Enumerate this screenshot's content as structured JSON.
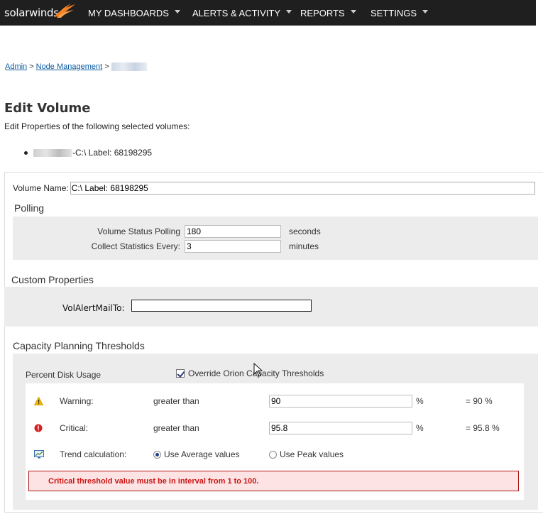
{
  "header": {
    "logo_text": "solarwinds",
    "nav": [
      "MY DASHBOARDS",
      "ALERTS & ACTIVITY",
      "REPORTS",
      "SETTINGS"
    ],
    "bg_color": "#1f1f1f",
    "accent_color": "#f47c20"
  },
  "breadcrumb": {
    "items": [
      "Admin",
      "Node Management"
    ],
    "separator": ">"
  },
  "page": {
    "title": "Edit Volume",
    "subtitle": "Edit Properties of the following selected volumes:",
    "selected_volume_suffix": "-C:\\ Label: 68198295"
  },
  "form": {
    "volume_name_label": "Volume Name:",
    "volume_name_value": "C:\\ Label: 68198295",
    "polling": {
      "title": "Polling",
      "status_label": "Volume Status Polling",
      "status_value": "180",
      "status_unit": "seconds",
      "stats_label": "Collect Statistics Every:",
      "stats_value": "3",
      "stats_unit": "minutes"
    },
    "custom_properties": {
      "title": "Custom Properties",
      "field_label": "VolAlertMailTo:",
      "field_value": ""
    },
    "capacity": {
      "title": "Capacity Planning Thresholds",
      "metric_label": "Percent Disk Usage",
      "override_label": "Override Orion Capacity Thresholds",
      "override_checked": true,
      "warning": {
        "label": "Warning:",
        "comparison": "greater than",
        "value": "90",
        "unit": "%",
        "result": "= 90 %",
        "icon": "warning-triangle-icon"
      },
      "critical": {
        "label": "Critical:",
        "comparison": "greater than",
        "value": "95.8",
        "unit": "%",
        "result": "= 95.8 %",
        "icon": "critical-circle-icon"
      },
      "trend": {
        "label": "Trend calculation:",
        "option_average": "Use Average values",
        "option_peak": "Use Peak values",
        "selected": "average",
        "icon": "trend-chart-icon"
      },
      "error_message": "Critical threshold value must be in interval from 1 to 100."
    }
  }
}
